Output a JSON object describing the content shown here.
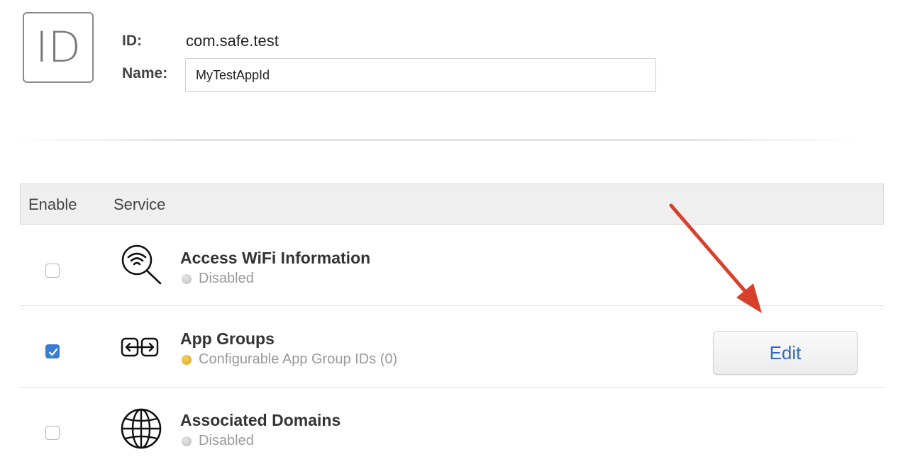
{
  "header": {
    "id_badge": "ID",
    "id_label": "ID:",
    "id_value": "com.safe.test",
    "name_label": "Name:",
    "name_value": "MyTestAppId"
  },
  "table": {
    "columns": [
      "Enable",
      "Service"
    ],
    "rows": [
      {
        "enabled": false,
        "icon": "wifi-search-icon",
        "name": "Access WiFi Information",
        "status": "Disabled",
        "status_color": "#bdbdbd"
      },
      {
        "enabled": true,
        "icon": "app-groups-icon",
        "name": "App Groups",
        "status": "Configurable App Group IDs (0)",
        "status_color": "#e0a82b",
        "action_label": "Edit"
      },
      {
        "enabled": false,
        "icon": "globe-icon",
        "name": "Associated Domains",
        "status": "Disabled",
        "status_color": "#bdbdbd"
      }
    ]
  },
  "colors": {
    "accent": "#2f6cc4",
    "checkbox_checked": "#3a7bd5",
    "annotation_arrow": "#d9402b"
  }
}
